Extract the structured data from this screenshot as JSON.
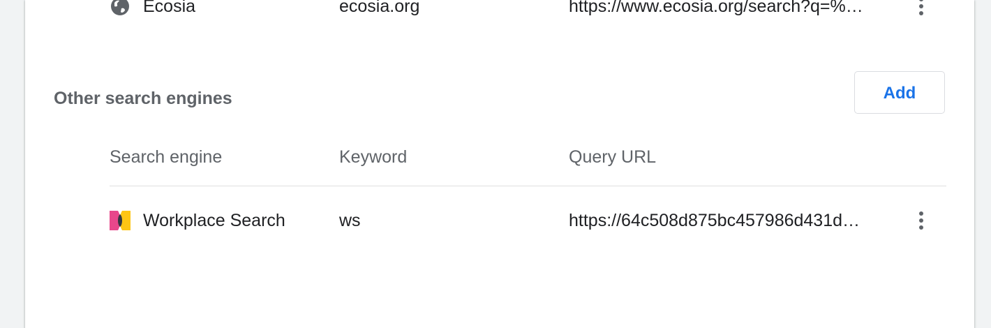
{
  "default_engines": {
    "rows": [
      {
        "name": "Ecosia",
        "keyword": "ecosia.org",
        "url": "https://www.ecosia.org/search?q=%…",
        "icon": "globe-icon"
      }
    ]
  },
  "other_engines": {
    "title": "Other search engines",
    "add_label": "Add",
    "columns": {
      "name": "Search engine",
      "keyword": "Keyword",
      "url": "Query URL"
    },
    "rows": [
      {
        "name": "Workplace Search",
        "keyword": "ws",
        "url": "https://64c508d875bc457986d431d…",
        "icon": "workplace-search-icon"
      }
    ]
  },
  "colors": {
    "accent": "#1a73e8",
    "text_primary": "#202124",
    "text_secondary": "#5f6368",
    "background": "#f1f3f4",
    "card": "#ffffff",
    "divider": "#e0e0e0",
    "workplace_pink": "#e8478b",
    "workplace_yellow": "#fec514",
    "workplace_dark": "#343741"
  }
}
